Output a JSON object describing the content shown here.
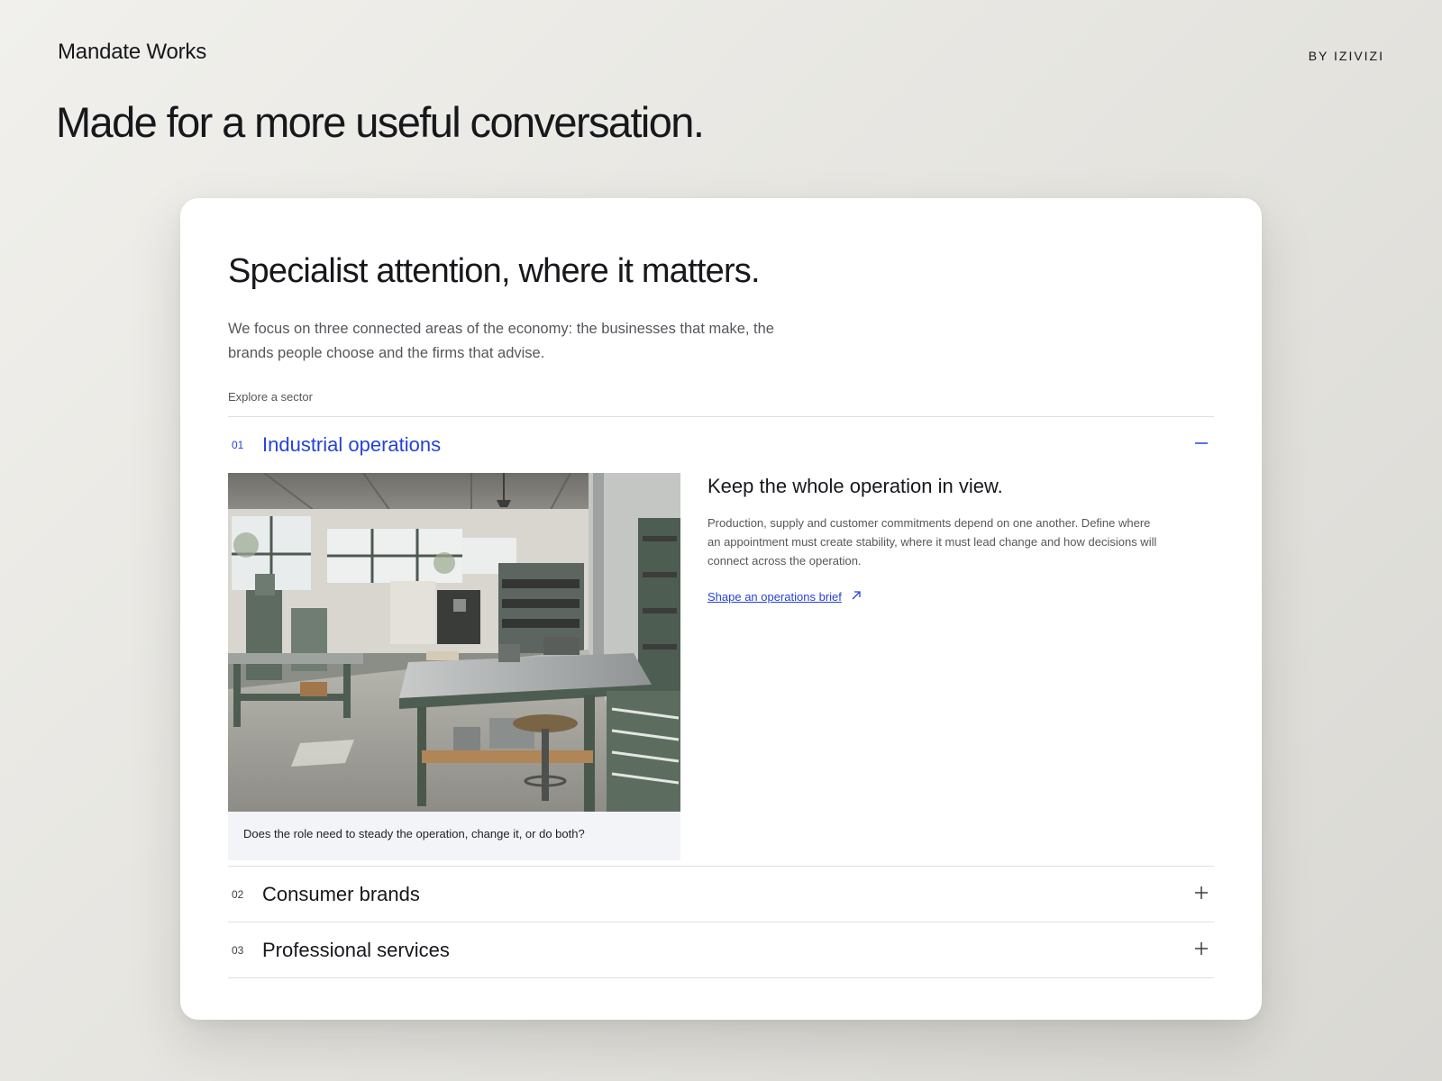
{
  "header": {
    "brand": "Mandate Works",
    "byline": "BY IZIVIZI",
    "headline": "Made for a more useful conversation."
  },
  "card": {
    "title": "Specialist attention, where it matters.",
    "intro": "We focus on three connected areas of the economy: the businesses that make, the brands people choose and the firms that advise.",
    "explore_label": "Explore a sector",
    "sectors": [
      {
        "number": "01",
        "title": "Industrial operations",
        "expanded": true,
        "toggle_icon": "minus-icon",
        "image_subject": "industrial workshop with workbenches and machinery",
        "caption": "Does the role need to steady the operation, change it, or do both?",
        "panel_title": "Keep the whole operation in view.",
        "panel_text": "Production, supply and customer commitments depend on one another. Define where an appointment must create stability, where it must lead change and how decisions will connect across the operation.",
        "link_label": "Shape an operations brief",
        "link_icon": "arrow-up-right-icon"
      },
      {
        "number": "02",
        "title": "Consumer brands",
        "expanded": false,
        "toggle_icon": "plus-icon"
      },
      {
        "number": "03",
        "title": "Professional services",
        "expanded": false,
        "toggle_icon": "plus-icon"
      }
    ]
  },
  "colors": {
    "accent": "#2643d6",
    "text": "#17181c",
    "muted": "#55575c",
    "caption_bg": "#f3f4f7",
    "divider": "#dedfe2"
  }
}
